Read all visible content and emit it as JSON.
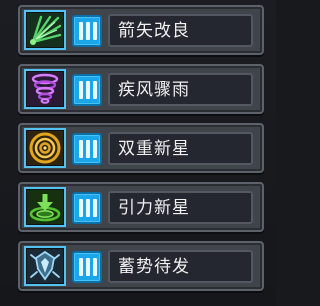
{
  "skills": [
    {
      "name": "箭矢改良",
      "icon": "arrow-burst-icon",
      "icon_color": "#54d36a"
    },
    {
      "name": "疾风骤雨",
      "icon": "whirlwind-icon",
      "icon_color": "#b04de0"
    },
    {
      "name": "双重新星",
      "icon": "double-nova-icon",
      "icon_color": "#e2a51e"
    },
    {
      "name": "引力新星",
      "icon": "gravity-nova-icon",
      "icon_color": "#55c233"
    },
    {
      "name": "蓄势待发",
      "icon": "charged-armor-icon",
      "icon_color": "#7fb6d8"
    }
  ],
  "colors": {
    "frame_highlight": "#53c2f0",
    "level_badge": "#1aa6e8",
    "row_bg": "#40444b",
    "name_bg": "#242730",
    "text": "#f0f0f0"
  }
}
